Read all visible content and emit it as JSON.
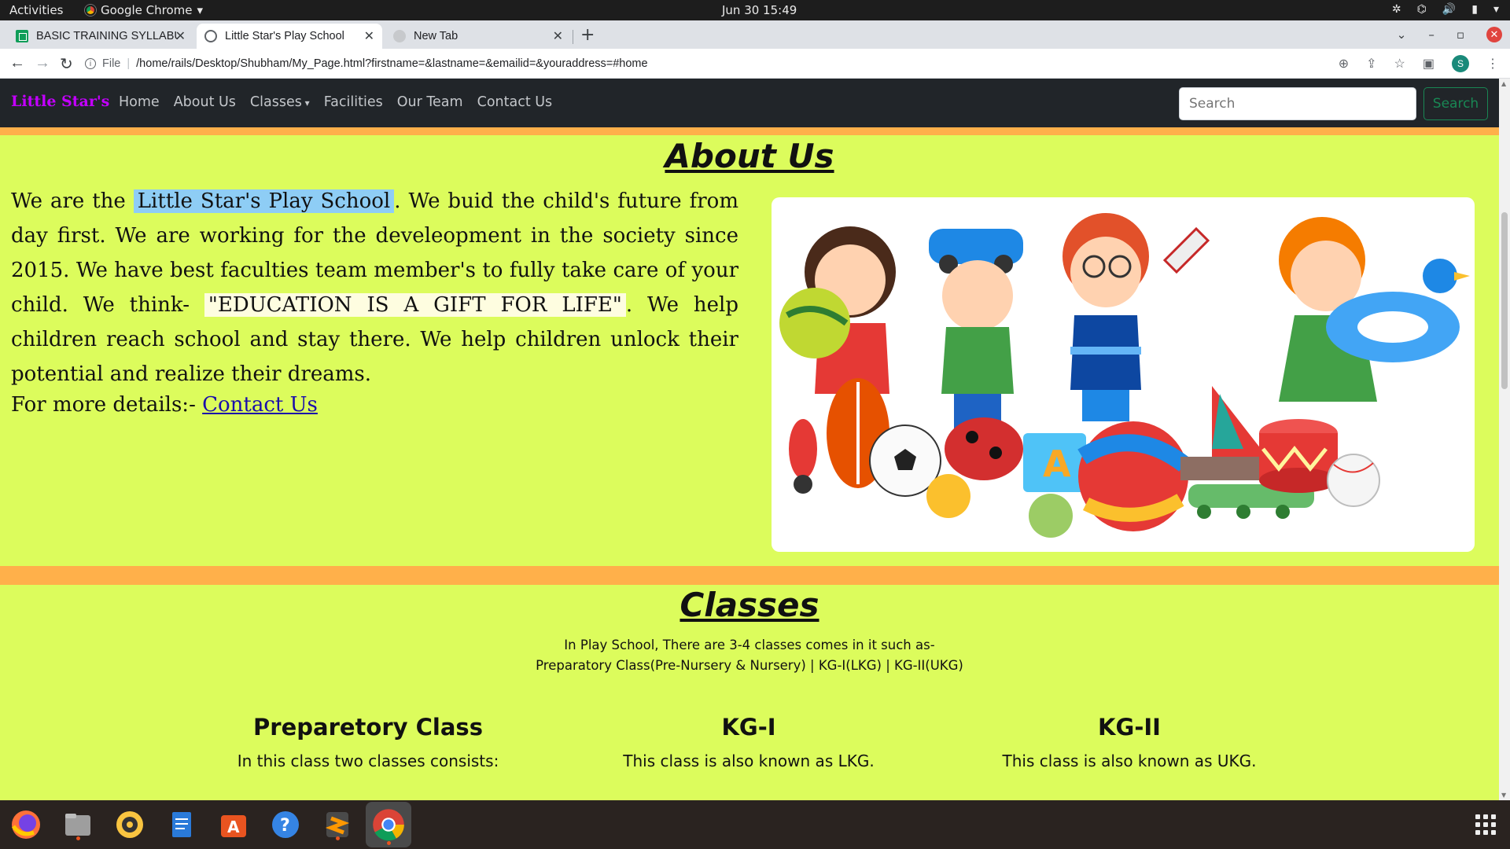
{
  "system": {
    "activities": "Activities",
    "app_name": "Google Chrome",
    "clock": "Jun 30  15:49"
  },
  "tabs": [
    {
      "title": "BASIC TRAINING SYLLABU",
      "icon": "sheets-icon"
    },
    {
      "title": "Little Star's Play School",
      "icon": "globe-icon"
    },
    {
      "title": "New Tab",
      "icon": "newtab-icon"
    }
  ],
  "omnibox": {
    "scheme": "File",
    "url": "/home/rails/Desktop/Shubham/My_Page.html?firstname=&lastname=&emailid=&youraddress=#home"
  },
  "navbar": {
    "brand": "Little Star's",
    "links": [
      "Home",
      "About Us",
      "Classes",
      "Facilities",
      "Our Team",
      "Contact Us"
    ],
    "search_placeholder": "Search",
    "search_button": "Search"
  },
  "about": {
    "heading": "About Us",
    "text_before": "We are the ",
    "highlight_name": "Little Star's Play School",
    "text_mid": ". We buid the child's future from day first. We are working for the develeopment in the society since 2015. We have best faculties team member's to fully take care of your child. We think- ",
    "highlight_quote": "\"EDUCATION IS A GIFT FOR LIFE\"",
    "text_after": ". We help children reach school and stay there. We help children unlock their potential and realize their dreams.",
    "more_label": "For more details:- ",
    "more_link": "Contact Us"
  },
  "classes": {
    "heading": "Classes",
    "intro_line1": "In Play School, There are 3-4 classes comes in it such as-",
    "intro_line2": "Preparatory Class(Pre-Nursery & Nursery) | KG-I(LKG) | KG-II(UKG)",
    "columns": [
      {
        "title": "Preparetory Class",
        "desc": "In this class two classes consists:"
      },
      {
        "title": "KG-I",
        "desc": "This class is also known as LKG."
      },
      {
        "title": "KG-II",
        "desc": "This class is also known as UKG."
      }
    ]
  },
  "colors": {
    "page_bg": "#dcfc5c",
    "band": "#ffb04a",
    "navbar": "#212529",
    "brand": "#c400ff",
    "search_btn": "#198754"
  },
  "dock": [
    "firefox-icon",
    "files-icon",
    "rhythmbox-icon",
    "writer-icon",
    "software-icon",
    "help-icon",
    "sublime-icon",
    "chrome-icon"
  ]
}
